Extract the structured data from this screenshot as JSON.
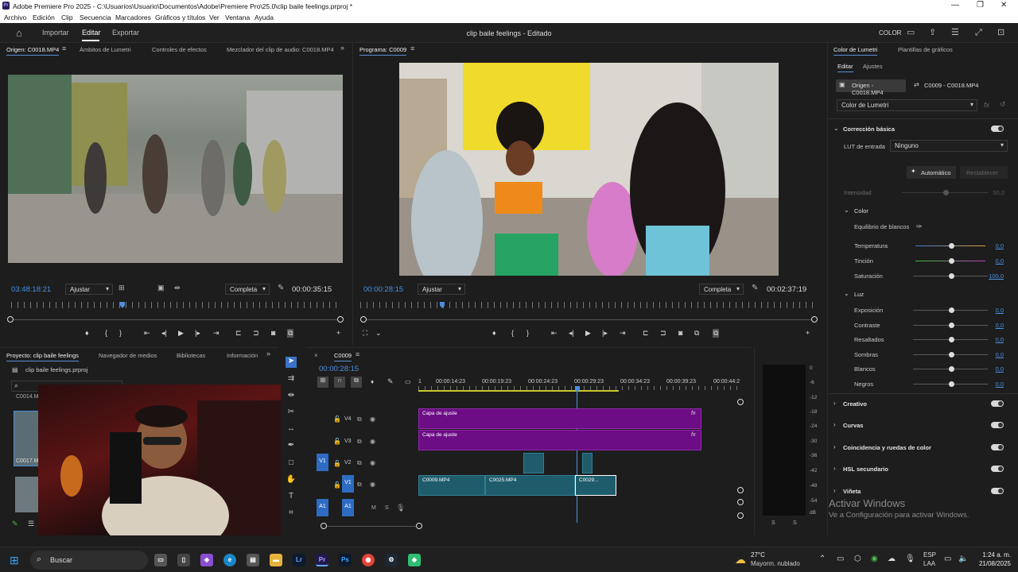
{
  "window": {
    "title": "Adobe Premiere Pro 2025 - C:\\Usuarios\\Usuario\\Documentos\\Adobe\\Premiere Pro\\25.0\\clip baile feelings.prproj *",
    "app_badge": "Pr"
  },
  "menu": [
    "Archivo",
    "Edición",
    "Clip",
    "Secuencia",
    "Marcadores",
    "Gráficos y títulos",
    "Ver",
    "Ventana",
    "Ayuda"
  ],
  "header": {
    "import": "Importar",
    "edit": "Editar",
    "export": "Exportar",
    "project_title": "clip baile feelings - Editado",
    "color_label": "COLOR"
  },
  "source_monitor": {
    "tabs": [
      "Origen: C0018.MP4",
      "Ámbitos de Lumetri",
      "Controles de efectos",
      "Mezclador del clip de audio: C0018.MP4"
    ],
    "timecode": "03:48:18:21",
    "fit": "Ajustar",
    "quality": "Completa",
    "duration": "00:00:35:15"
  },
  "program_monitor": {
    "tab": "Programa: C0009",
    "timecode": "00:00:28:15",
    "fit": "Ajustar",
    "quality": "Completa",
    "duration": "00:02:37:19"
  },
  "project_panel": {
    "tabs": [
      "Proyecto: clip baile feelings",
      "Navegador de medios",
      "Bibliotecas",
      "Información"
    ],
    "file": "clip baile feelings.prproj",
    "items": [
      "C0014.M",
      "C0017.M"
    ]
  },
  "timeline": {
    "sequence": "C0009",
    "timecode": "00:00:28:15",
    "ruler": [
      "1",
      "00:00:14:23",
      "00:00:19:23",
      "00:00:24:23",
      "00:00:29:23",
      "00:00:34:23",
      "00:00:39:23",
      "00:00:44:2"
    ],
    "tracks": {
      "v4": "V4",
      "v3": "V3",
      "v2": "V2",
      "v1": "V1",
      "a1": "A1",
      "v1_src": "V1",
      "a1_src": "A1"
    },
    "clips": {
      "adj1": "Capa de ajuste",
      "adj2": "Capa de ajuste",
      "c1": "C0009.MP4",
      "c2": "C0025.MP4",
      "c3": "C0029..."
    },
    "fx": "fx",
    "audio_track_btns": [
      "M",
      "S"
    ]
  },
  "audio_meter": {
    "scale": [
      "0",
      "-6",
      "-12",
      "-18",
      "-24",
      "-30",
      "-36",
      "-42",
      "-48",
      "-54",
      "dB"
    ],
    "solo": [
      "S",
      "S"
    ]
  },
  "lumetri": {
    "tabs": [
      "Color de Lumetri",
      "Plantillas de gráficos"
    ],
    "subtabs": [
      "Editar",
      "Ajustes"
    ],
    "origin_btn": "Origen - C0018.MP4",
    "seq_btn": "C0009 - C0018.MP4",
    "effect_select": "Color de Lumetri",
    "basic": "Corrección básica",
    "lut_label": "LUT de entrada",
    "lut_value": "Ninguno",
    "auto": "Automático",
    "reset": "Restablecer",
    "intensity_label": "Intensidad",
    "intensity_value": "50,0",
    "color_section": "Color",
    "wb_label": "Equilibrio de blancos",
    "sliders": [
      {
        "label": "Temperatura",
        "value": "0,0"
      },
      {
        "label": "Tinción",
        "value": "0,0"
      },
      {
        "label": "Saturación",
        "value": "100,0"
      }
    ],
    "light_section": "Luz",
    "light_sliders": [
      {
        "label": "Exposición",
        "value": "0,0"
      },
      {
        "label": "Contraste",
        "value": "0,0"
      },
      {
        "label": "Resaltados",
        "value": "0,0"
      },
      {
        "label": "Sombras",
        "value": "0,0"
      },
      {
        "label": "Blancos",
        "value": "0,0"
      },
      {
        "label": "Negros",
        "value": "0,0"
      }
    ],
    "sections": [
      "Creativo",
      "Curvas",
      "Coincidencia y ruedas de color",
      "HSL secundario",
      "Viñeta"
    ],
    "watermark_title": "Activar Windows",
    "watermark_sub": "Ve a Configuración para activar Windows."
  },
  "taskbar": {
    "search": "Buscar",
    "weather_temp": "27°C",
    "weather_desc": "Mayorm. nublado",
    "lang1": "ESP",
    "lang2": "LAA",
    "time": "1:24 a. m.",
    "date": "21/08/2025",
    "apps": [
      "Lr",
      "Pr",
      "Ps"
    ]
  }
}
